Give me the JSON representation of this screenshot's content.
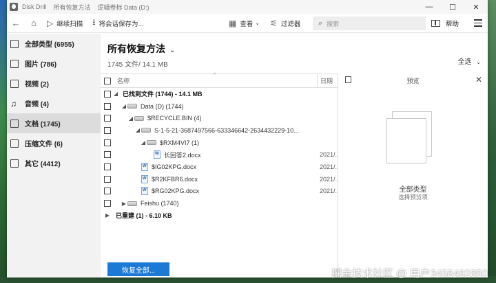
{
  "titlebar": {
    "app_name": "Disk Drill",
    "crumb1": "所有恢复方法",
    "crumb2": "逻辑卷标 Data (D:)",
    "minimize": "—",
    "maximize": "☐",
    "close": "✕"
  },
  "toolbar": {
    "resume_scan": "继续扫描",
    "save_session": "将会话保存为...",
    "view": "查看",
    "filter": "过滤器",
    "search_placeholder": "搜索",
    "help": "帮助"
  },
  "sidebar": {
    "items": [
      {
        "label": "全部类型 (6955)",
        "icon": "file-icon"
      },
      {
        "label": "图片 (786)",
        "icon": "image-icon"
      },
      {
        "label": "视频 (2)",
        "icon": "video-icon"
      },
      {
        "label": "音频 (4)",
        "icon": "music-icon"
      },
      {
        "label": "文档 (1745)",
        "icon": "document-icon"
      },
      {
        "label": "压缩文件 (6)",
        "icon": "archive-icon"
      },
      {
        "label": "其它 (4412)",
        "icon": "other-icon"
      }
    ]
  },
  "main": {
    "heading": "所有恢复方法",
    "subheading": "1745 文件/ 14.1 MB",
    "select_all": "全选"
  },
  "table": {
    "col_name": "名称",
    "col_date": "日期",
    "rows": [
      {
        "label": "已找到文件 (1744) - 14.1 MB",
        "date": ""
      },
      {
        "label": "Data (D) (1744)",
        "date": ""
      },
      {
        "label": "$RECYCLE.BIN (4)",
        "date": ""
      },
      {
        "label": "S-1-5-21-3687497566-633346642-2634432229-10...",
        "date": ""
      },
      {
        "label": "$RXM4VI7 (1)",
        "date": ""
      },
      {
        "label": "长回答2.docx",
        "date": "2021/..."
      },
      {
        "label": "$IG02KPG.docx",
        "date": "2021/..."
      },
      {
        "label": "$R2KFBR6.docx",
        "date": "2021/..."
      },
      {
        "label": "$RG02KPG.docx",
        "date": "2021/..."
      },
      {
        "label": "Feishu (1740)",
        "date": ""
      },
      {
        "label": "已重建 (1) - 6.10 KB",
        "date": ""
      }
    ]
  },
  "preview": {
    "title": "预览",
    "type_label": "全部类型",
    "hint": "选择预览项"
  },
  "footer": {
    "recover_all": "恢复全部..."
  },
  "watermark": "掘金技术社区 @ 用户3458482850"
}
